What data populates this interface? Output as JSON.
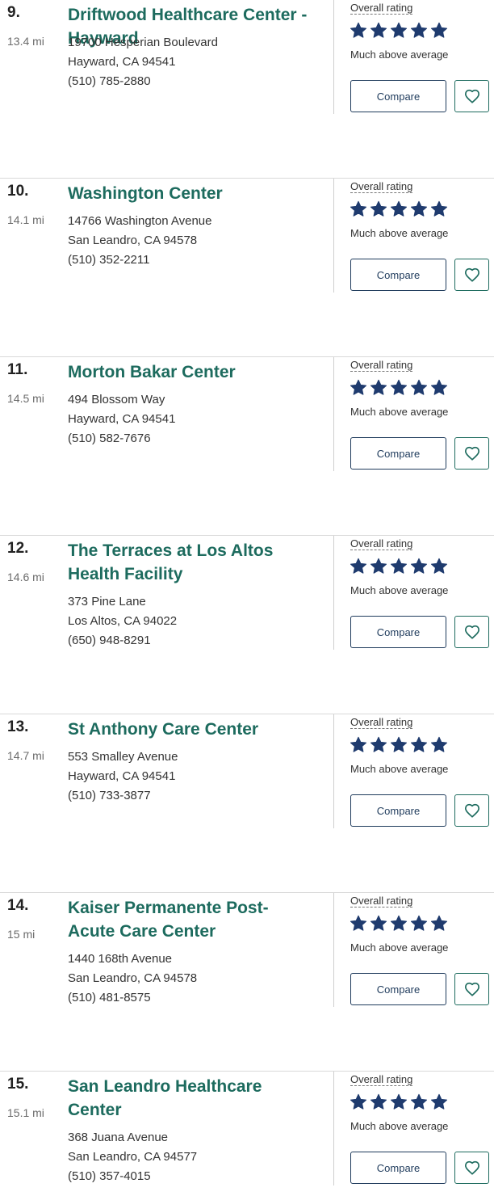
{
  "colors": {
    "name_link": "#1d6b5e",
    "star": "#1f3b6e",
    "compare_border": "#1f3b5c",
    "favorite_border": "#1d6b5e"
  },
  "facilities": [
    {
      "rank": "9.",
      "distance": "13.4 mi",
      "name": "Driftwood Healthcare Center - Hayward",
      "address_line1": "19700 Hesperian Boulevard",
      "address_line2": "Hayward, CA 94541",
      "phone": "(510) 785-2880",
      "rating_label": "Overall rating",
      "stars": 5,
      "rating_text": "Much above average",
      "compare_label": "Compare",
      "favorite_icon": "heart-icon"
    },
    {
      "rank": "10.",
      "distance": "14.1 mi",
      "name": "Washington Center",
      "address_line1": "14766 Washington Avenue",
      "address_line2": "San Leandro, CA 94578",
      "phone": "(510) 352-2211",
      "rating_label": "Overall rating",
      "stars": 5,
      "rating_text": "Much above average",
      "compare_label": "Compare",
      "favorite_icon": "heart-icon"
    },
    {
      "rank": "11.",
      "distance": "14.5 mi",
      "name": "Morton Bakar Center",
      "address_line1": "494 Blossom Way",
      "address_line2": "Hayward, CA 94541",
      "phone": "(510) 582-7676",
      "rating_label": "Overall rating",
      "stars": 5,
      "rating_text": "Much above average",
      "compare_label": "Compare",
      "favorite_icon": "heart-icon"
    },
    {
      "rank": "12.",
      "distance": "14.6 mi",
      "name": "The Terraces at Los Altos Health Facility",
      "address_line1": "373 Pine Lane",
      "address_line2": "Los Altos, CA 94022",
      "phone": "(650) 948-8291",
      "rating_label": "Overall rating",
      "stars": 5,
      "rating_text": "Much above average",
      "compare_label": "Compare",
      "favorite_icon": "heart-icon"
    },
    {
      "rank": "13.",
      "distance": "14.7 mi",
      "name": "St Anthony Care Center",
      "address_line1": "553 Smalley Avenue",
      "address_line2": "Hayward, CA 94541",
      "phone": "(510) 733-3877",
      "rating_label": "Overall rating",
      "stars": 5,
      "rating_text": "Much above average",
      "compare_label": "Compare",
      "favorite_icon": "heart-icon"
    },
    {
      "rank": "14.",
      "distance": "15 mi",
      "name": "Kaiser Permanente Post-Acute Care Center",
      "address_line1": "1440 168th Avenue",
      "address_line2": "San Leandro, CA 94578",
      "phone": "(510) 481-8575",
      "rating_label": "Overall rating",
      "stars": 5,
      "rating_text": "Much above average",
      "compare_label": "Compare",
      "favorite_icon": "heart-icon"
    },
    {
      "rank": "15.",
      "distance": "15.1 mi",
      "name": "San Leandro Healthcare Center",
      "address_line1": "368 Juana Avenue",
      "address_line2": "San Leandro, CA 94577",
      "phone": "(510) 357-4015",
      "rating_label": "Overall rating",
      "stars": 5,
      "rating_text": "Much above average",
      "compare_label": "Compare",
      "favorite_icon": "heart-icon"
    }
  ]
}
